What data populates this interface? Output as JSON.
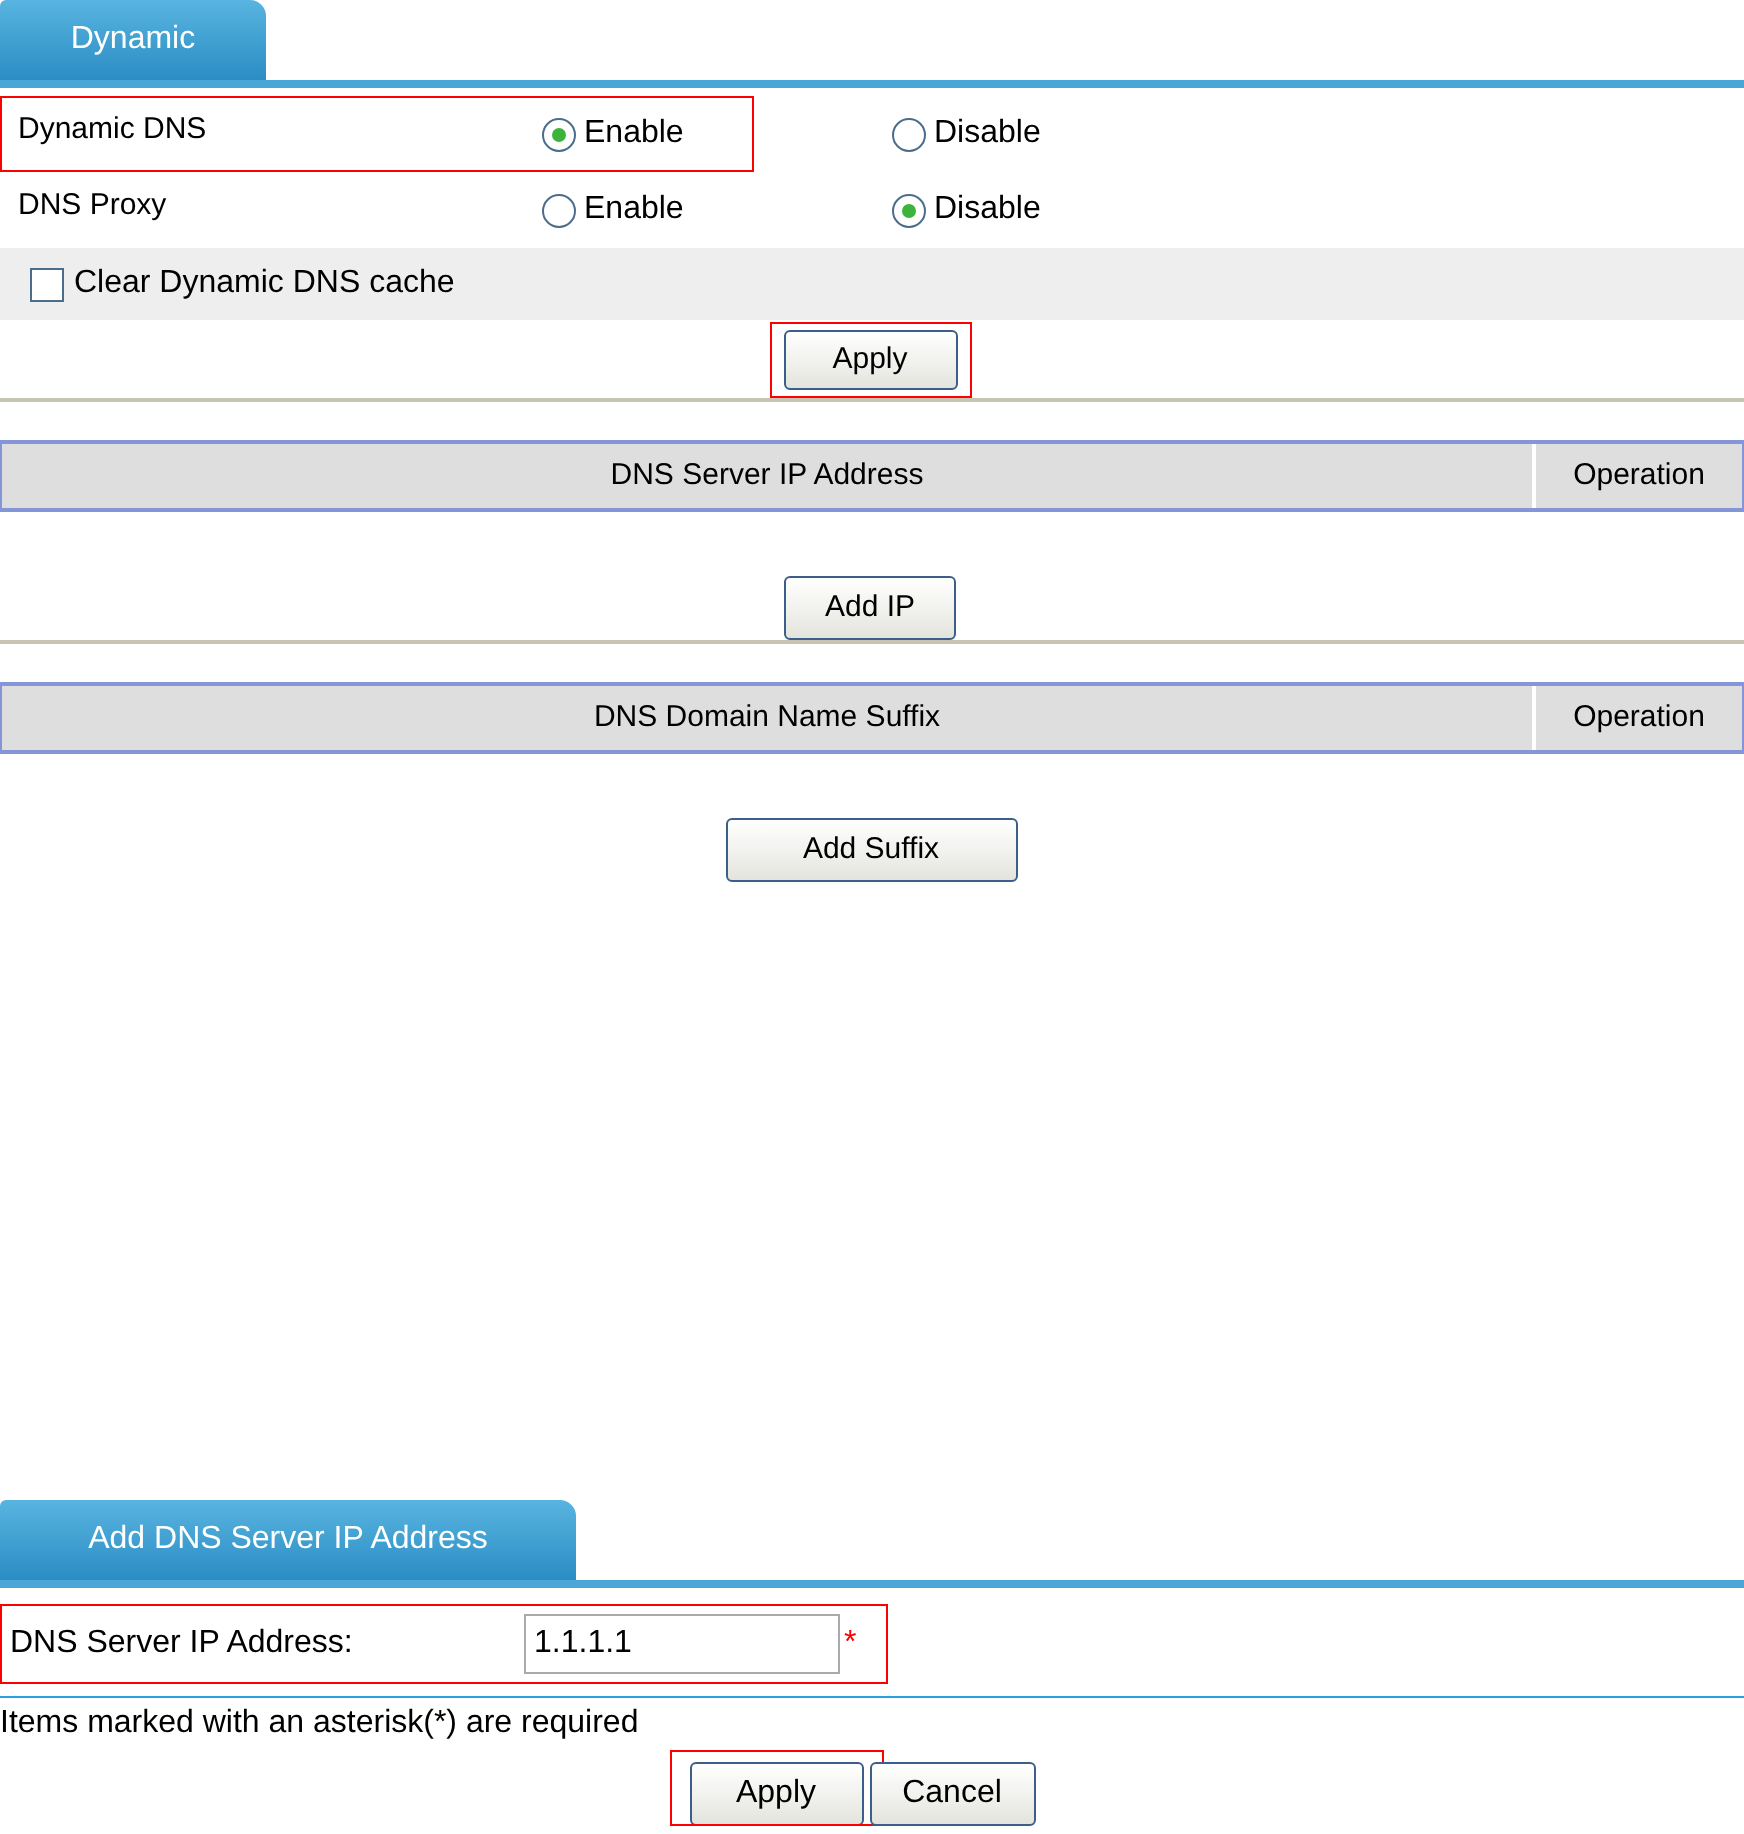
{
  "top_tab": {
    "label": "Dynamic",
    "selected": true
  },
  "settings": [
    {
      "label": "Dynamic DNS",
      "highlighted": true,
      "options": [
        {
          "label": "Enable",
          "selected": true
        },
        {
          "label": "Disable",
          "selected": false
        }
      ]
    },
    {
      "label": "DNS Proxy",
      "highlighted": false,
      "options": [
        {
          "label": "Enable",
          "selected": false
        },
        {
          "label": "Disable",
          "selected": true
        }
      ]
    }
  ],
  "clear_cache": {
    "label": "Clear Dynamic DNS cache",
    "checked": false
  },
  "apply_button": {
    "label": "Apply",
    "highlighted": true
  },
  "tables": [
    {
      "columns": [
        "DNS Server IP Address",
        "Operation"
      ],
      "button": "Add IP"
    },
    {
      "columns": [
        "DNS Domain Name Suffix",
        "Operation"
      ],
      "button": "Add Suffix"
    }
  ],
  "add_panel": {
    "tab": {
      "label": "Add DNS Server IP Address",
      "selected": true
    },
    "field": {
      "label": "DNS Server IP Address:",
      "value": "1.1.1.1",
      "required_mark": "*",
      "highlighted": true
    },
    "note": "Items marked with an asterisk(*) are required",
    "buttons": [
      {
        "label": "Apply",
        "highlighted": true
      },
      {
        "label": "Cancel",
        "highlighted": false
      }
    ]
  }
}
